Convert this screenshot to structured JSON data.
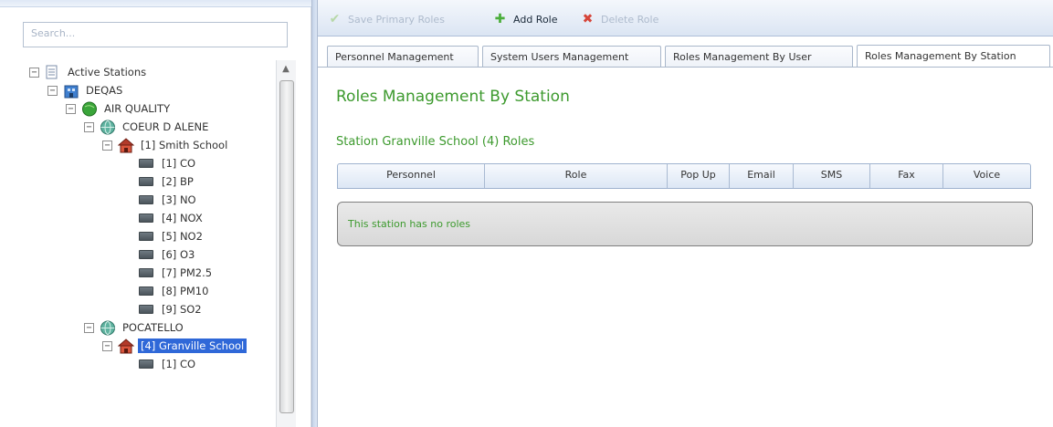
{
  "search": {
    "placeholder": "Search..."
  },
  "tree": {
    "nodes": [
      {
        "label": "Active Stations",
        "icon": "page-icon",
        "toggle": "⊟"
      },
      {
        "label": "DEQAS",
        "icon": "building-icon",
        "toggle": "⊟"
      },
      {
        "label": "AIR QUALITY",
        "icon": "green-globe-icon",
        "toggle": "⊟"
      },
      {
        "label": "COEUR D ALENE",
        "icon": "city-globe-icon",
        "toggle": "⊟"
      },
      {
        "label": "[1] Smith School",
        "icon": "station-house-icon",
        "toggle": "⊟"
      },
      {
        "label": "[1] CO",
        "icon": "sensor-icon"
      },
      {
        "label": "[2] BP",
        "icon": "sensor-icon"
      },
      {
        "label": "[3] NO",
        "icon": "sensor-icon"
      },
      {
        "label": "[4] NOX",
        "icon": "sensor-icon"
      },
      {
        "label": "[5] NO2",
        "icon": "sensor-icon"
      },
      {
        "label": "[6] O3",
        "icon": "sensor-icon"
      },
      {
        "label": "[7] PM2.5",
        "icon": "sensor-icon"
      },
      {
        "label": "[8] PM10",
        "icon": "sensor-icon"
      },
      {
        "label": "[9] SO2",
        "icon": "sensor-icon"
      },
      {
        "label": "POCATELLO",
        "icon": "city-globe-icon",
        "toggle": "⊟"
      },
      {
        "label": "[4] Granville School",
        "icon": "station-house-icon",
        "toggle": "⊟",
        "selected": true
      },
      {
        "label": "[1] CO",
        "icon": "sensor-icon"
      }
    ]
  },
  "toolbar": {
    "save_label": "Save Primary Roles",
    "add_label": "Add Role",
    "delete_label": "Delete Role"
  },
  "tabs": [
    {
      "label": "Personnel Management"
    },
    {
      "label": "System Users Management"
    },
    {
      "label": "Roles Management By User"
    },
    {
      "label": "Roles Management By Station",
      "active": true
    }
  ],
  "content": {
    "page_title": "Roles Management By Station",
    "station_title": "Station Granville School (4) Roles",
    "table": {
      "columns": [
        "Personnel",
        "Role",
        "Pop Up",
        "Email",
        "SMS",
        "Fax",
        "Voice"
      ]
    },
    "empty_message": "This station has no roles"
  },
  "colors": {
    "accent_green": "#3d9a2e",
    "selection_blue": "#2f68d8",
    "header_blue": "#dde7f5"
  }
}
